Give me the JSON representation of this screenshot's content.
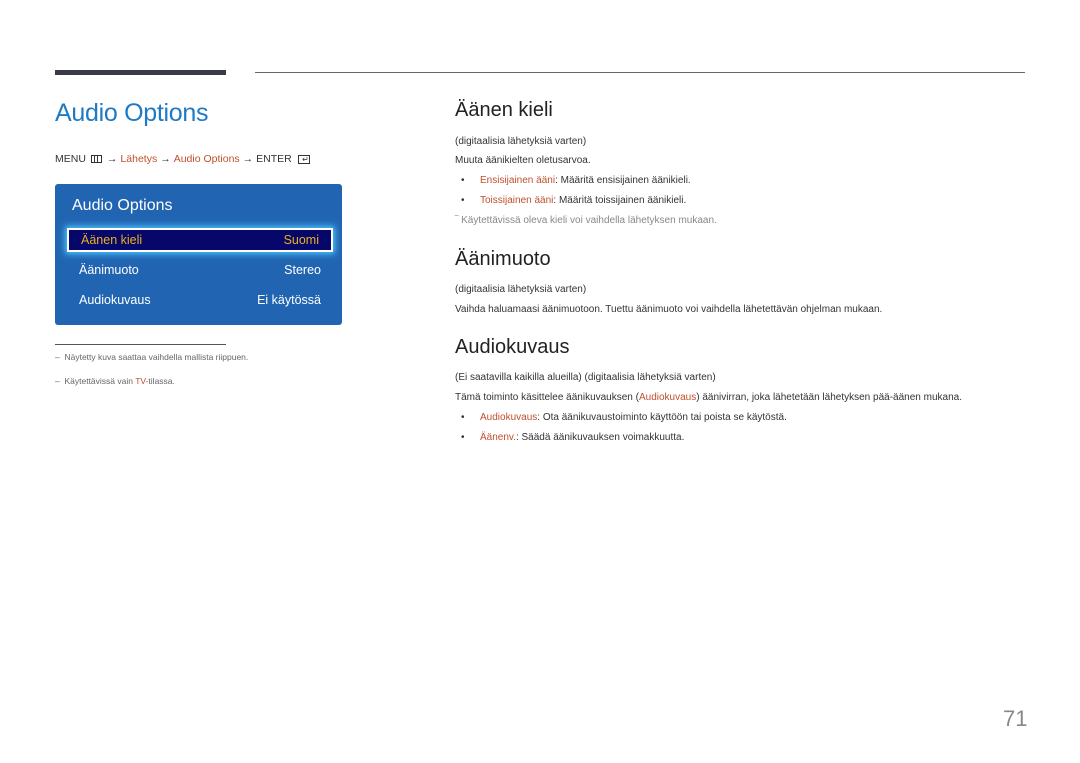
{
  "page_title": "Audio Options",
  "breadcrumb": {
    "menu": "MENU",
    "arrow": "→",
    "item1": "Lähetys",
    "item2": "Audio Options",
    "enter": "ENTER",
    "enter_glyph": "↵"
  },
  "osd": {
    "title": "Audio Options",
    "rows": [
      {
        "label": "Äänen kieli",
        "value": "Suomi"
      },
      {
        "label": "Äänimuoto",
        "value": "Stereo"
      },
      {
        "label": "Audiokuvaus",
        "value": "Ei käytössä"
      }
    ]
  },
  "footnotes": {
    "dash": "–",
    "note1": "Näytetty kuva saattaa vaihdella mallista riippuen.",
    "note2_pre": "Käytettävissä vain ",
    "note2_accent": "TV",
    "note2_post": "-tilassa."
  },
  "sections": {
    "language": {
      "heading": "Äänen kieli",
      "qualifier": "(digitaalisia lähetyksiä varten)",
      "description": "Muuta äänikielten oletusarvoa.",
      "bullets": [
        {
          "term": "Ensisijainen ääni",
          "text": ": Määritä ensisijainen äänikieli."
        },
        {
          "term": "Toissijainen ääni",
          "text": ": Määritä toissijainen äänikieli."
        }
      ],
      "note": "‾ Käytettävissä oleva kieli voi vaihdella lähetyksen mukaan."
    },
    "format": {
      "heading": "Äänimuoto",
      "qualifier": "(digitaalisia lähetyksiä varten)",
      "description": "Vaihda haluamaasi äänimuotoon. Tuettu äänimuoto voi vaihdella lähetettävän ohjelman mukaan."
    },
    "audio_description": {
      "heading": "Audiokuvaus",
      "qualifier": "(Ei saatavilla kaikilla alueilla) (digitaalisia lähetyksiä varten)",
      "desc_pre": "Tämä toiminto käsittelee äänikuvauksen (",
      "desc_accent": "Audiokuvaus",
      "desc_post": ") äänivirran, joka lähetetään lähetyksen pää-äänen mukana.",
      "bullets": [
        {
          "term": "Audiokuvaus",
          "text": ": Ota äänikuvaustoiminto käyttöön tai poista se käytöstä."
        },
        {
          "term": "Äänenv.",
          "text": ": Säädä äänikuvauksen voimakkuutta."
        }
      ]
    }
  },
  "bullet_glyph": "•",
  "page_number": "71"
}
